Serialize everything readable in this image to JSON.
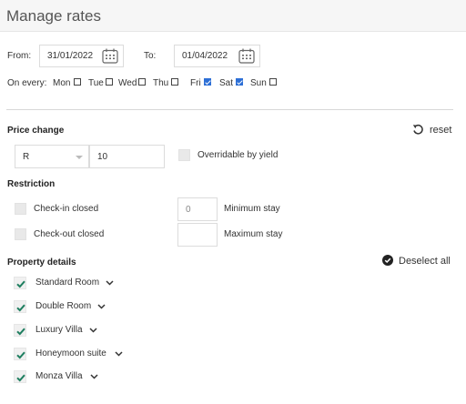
{
  "header": {
    "title": "Manage rates"
  },
  "dates": {
    "from_label": "From:",
    "from_value": "31/01/2022",
    "to_label": "To:",
    "to_value": "01/04/2022",
    "on_every_label": "On every:",
    "days": [
      {
        "label": "Mon",
        "checked": false
      },
      {
        "label": "Tue",
        "checked": false
      },
      {
        "label": "Wed",
        "checked": false
      },
      {
        "label": "Thu",
        "checked": false
      },
      {
        "label": "Fri",
        "checked": true
      },
      {
        "label": "Sat",
        "checked": true
      },
      {
        "label": "Sun",
        "checked": false
      }
    ]
  },
  "price_change": {
    "heading": "Price change",
    "reset_label": "reset",
    "currency_value": "R",
    "amount_value": "10",
    "overridable_label": "Overridable by yield",
    "overridable_checked": false
  },
  "restriction": {
    "heading": "Restriction",
    "checkin_label": "Check-in closed",
    "checkout_label": "Check-out closed",
    "min_stay_value": "0",
    "min_stay_label": "Minimum stay",
    "max_stay_value": "",
    "max_stay_label": "Maximum stay"
  },
  "property": {
    "heading": "Property details",
    "deselect_label": "Deselect all",
    "rooms": [
      {
        "label": "Standard Room",
        "checked": true
      },
      {
        "label": "Double Room",
        "checked": true
      },
      {
        "label": "Luxury Villa",
        "checked": true
      },
      {
        "label": "Honeymoon suite",
        "checked": true
      },
      {
        "label": "Monza Villa",
        "checked": true
      }
    ]
  },
  "colors": {
    "accent_check": "#2d6fd6",
    "property_check": "#1f7f60"
  }
}
